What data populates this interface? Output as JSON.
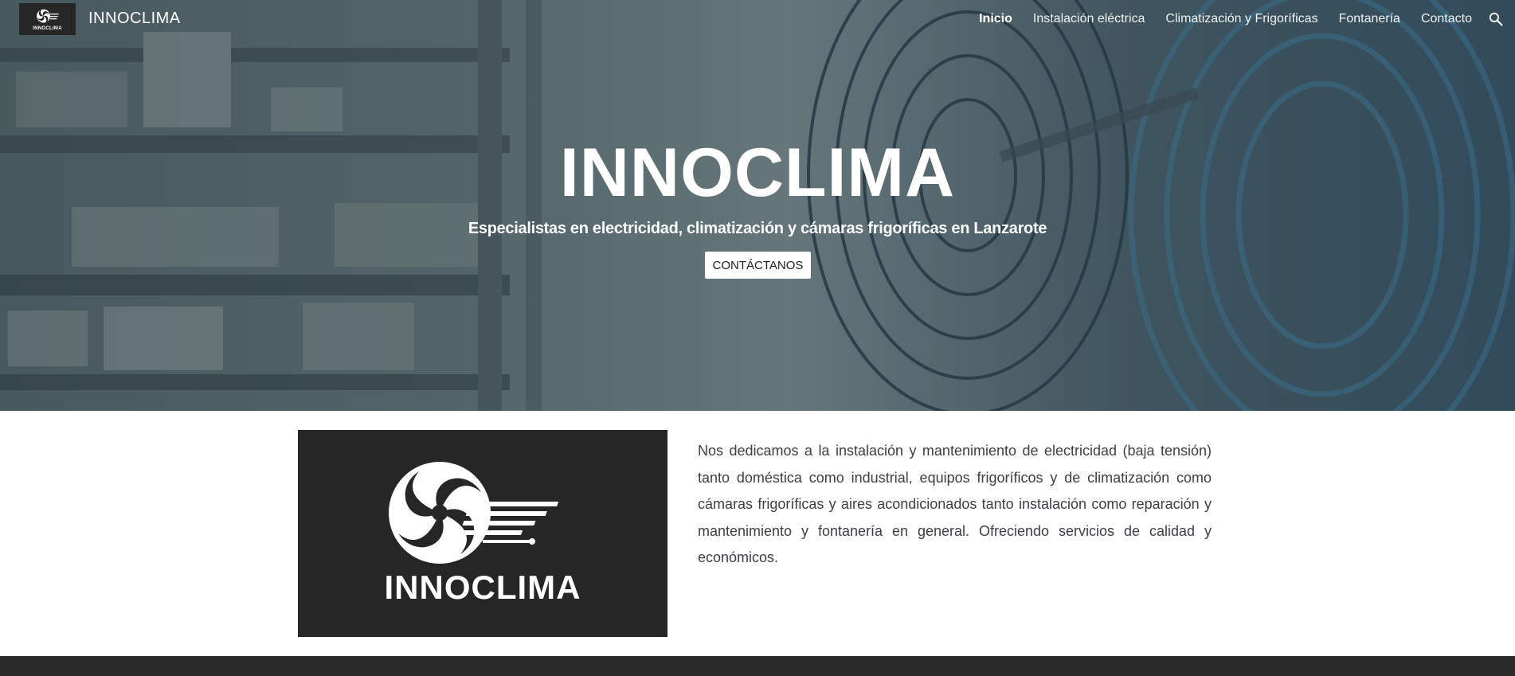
{
  "header": {
    "site_title": "INNOCLIMA",
    "logo_text": "INNOCLIMA",
    "nav": [
      {
        "label": "Inicio",
        "active": true
      },
      {
        "label": "Instalación eléctrica",
        "active": false
      },
      {
        "label": "Climatización y Frigoríficas",
        "active": false
      },
      {
        "label": "Fontanería",
        "active": false
      },
      {
        "label": "Contacto",
        "active": false
      }
    ],
    "search_icon": "search-icon"
  },
  "hero": {
    "title": "INNOCLIMA",
    "subtitle": "Especialistas en electricidad, climatización y cámaras frigoríficas en Lanzarote",
    "cta_label": "CONTÁCTANOS"
  },
  "about": {
    "logo_text": "INNOCLIMA",
    "description": "Nos dedicamos a la instalación y mantenimiento de electricidad (baja tensión) tanto doméstica como industrial, equipos frigoríficos y de climatización como cámaras frigoríficas y aires acondicionados tanto instalación como reparación y mantenimiento y fontanería en general. Ofreciendo servicios de calidad y económicos."
  },
  "colors": {
    "logo_bg": "#262626",
    "footer_bg": "#2b2b2b",
    "text": "#3c4043"
  }
}
